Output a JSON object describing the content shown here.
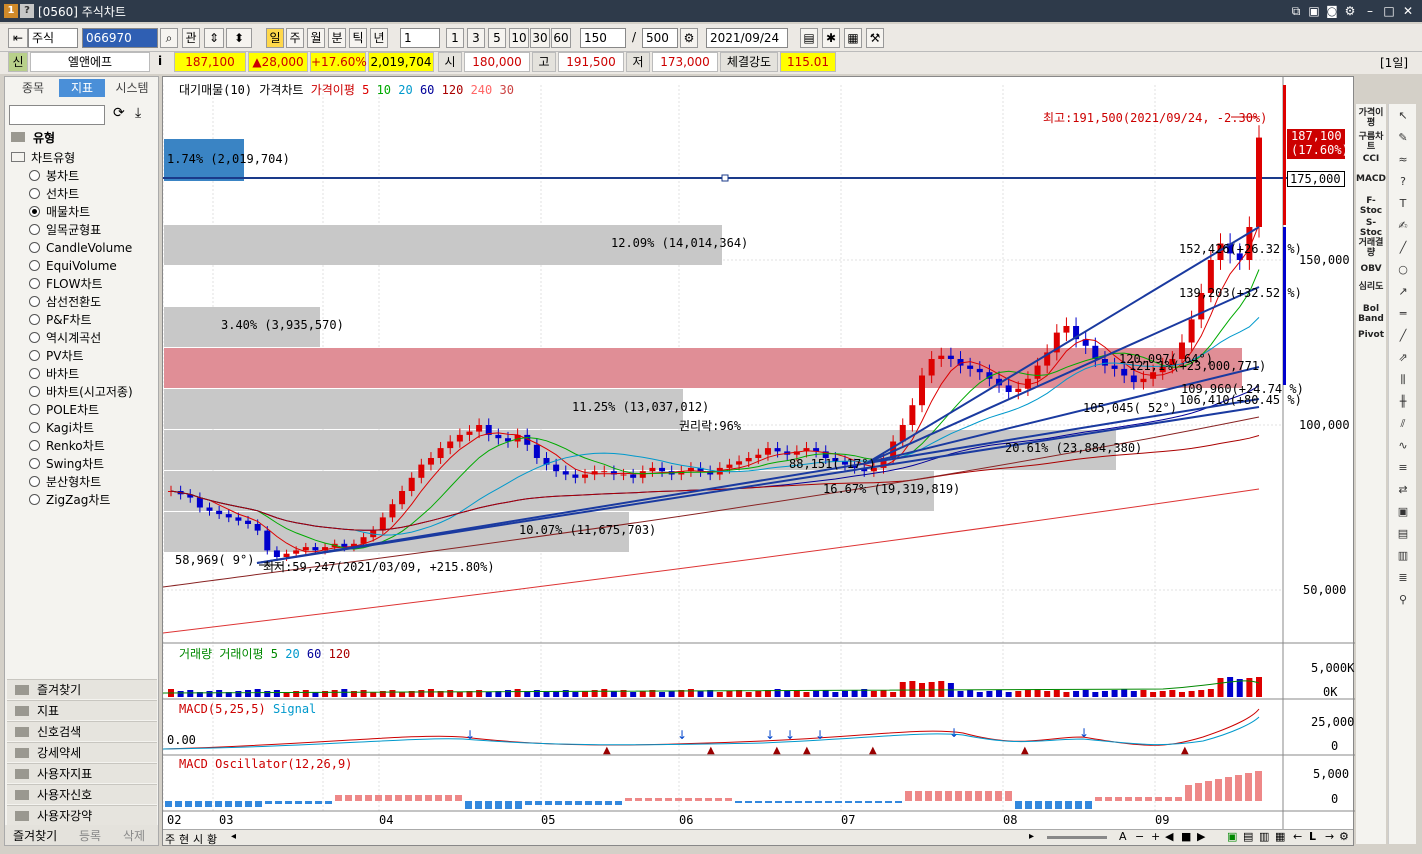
{
  "window": {
    "code": "[0560]",
    "title": "주식차트",
    "badge1": "1",
    "badge2": "?"
  },
  "toolbar": {
    "market": "주식",
    "code": "066970",
    "btn_gwan": "관",
    "periods": [
      "일",
      "주",
      "월",
      "분",
      "틱",
      "년"
    ],
    "interval": "1",
    "quick": [
      "1",
      "3",
      "5",
      "10",
      "30",
      "60"
    ],
    "count": "150",
    "slash": "/",
    "total": "500",
    "date": "2021/09/24"
  },
  "quote": {
    "badge": "신",
    "name": "엘앤에프",
    "info_icon": "i",
    "price": "187,100",
    "change": "▲28,000",
    "rate": "+17.60%",
    "volume": "2,019,704",
    "open_label": "시",
    "open": "180,000",
    "high_label": "고",
    "high": "191,500",
    "low_label": "저",
    "low": "173,000",
    "strength_label": "체결강도",
    "strength": "115.01",
    "period_tag": "[1일]"
  },
  "left": {
    "tabs": [
      "종목",
      "지표",
      "시스템"
    ],
    "active_tab": "지표",
    "section": "유형",
    "group": "차트유형",
    "types": [
      "봉차트",
      "선차트",
      "매물차트",
      "일목균형표",
      "CandleVolume",
      "EquiVolume",
      "FLOW차트",
      "삼선전환도",
      "P&F차트",
      "역시계곡선",
      "PV차트",
      "바차트",
      "바차트(시고저종)",
      "POLE차트",
      "Kagi차트",
      "Renko차트",
      "Swing차트",
      "분산형차트",
      "ZigZag차트"
    ],
    "selected": "매물차트",
    "folders": [
      "즐겨찾기",
      "지표",
      "신호검색",
      "강세약세",
      "사용자지표",
      "사용자신호",
      "사용자강약"
    ],
    "bottom_tabs": [
      "즐겨찾기",
      "등록",
      "삭제"
    ]
  },
  "main_legend": {
    "a": "대기매물(10)",
    "b": "가격차트",
    "c": "가격이평",
    "ma": [
      "5",
      "10",
      "20",
      "60",
      "120",
      "240",
      "30"
    ],
    "ma_colors": [
      "#dd0000",
      "#00aa00",
      "#0099cc",
      "#000099",
      "#aa0000",
      "#ff6666",
      "#cc4444"
    ]
  },
  "volume_profile": [
    {
      "label": "1.74% (2,019,704)",
      "pct": 1.74
    },
    {
      "label": "12.09% (14,014,364)",
      "pct": 12.09
    },
    {
      "label": "3.40% (3,935,570)",
      "pct": 3.4
    },
    {
      "label": "",
      "pct": 20.0
    },
    {
      "label": "11.25% (13,037,012)",
      "pct": 11.25
    },
    {
      "label": "20.61% (23,884,380)",
      "pct": 20.61
    },
    {
      "label": "16.67% (19,319,819)",
      "pct": 16.67
    },
    {
      "label": "10.07% (11,675,703)",
      "pct": 10.07
    }
  ],
  "annotations": {
    "high": "최고:191,500(2021/09/24, -2.30%)",
    "low": "최저:59,247(2021/03/09, +215.80%)",
    "rights": "권리락:96%",
    "t1": "58,969(  9°)",
    "t2": "88,151(  17°)",
    "t3": "105,045(  52°)",
    "t4": "106,410(+80.45 %)",
    "t5": "109,960(+24.74 %)",
    "t6": "120,097(  64°)",
    "t7": "121,1%(+23,000,771)",
    "t8": "139,203(+32.52 %)",
    "t9": "152,426(+26.32 %)"
  },
  "price_axis": {
    "labels": [
      "150,000",
      "100,000",
      "50,000"
    ],
    "line_value": "175,000",
    "last_price": "187,100",
    "last_rate": "(17.60%)"
  },
  "volume_panel": {
    "legend_a": "거래량",
    "legend_b": "거래이평",
    "ma": [
      "5",
      "20",
      "60",
      "120"
    ],
    "axis": [
      "5,000K",
      "0K"
    ]
  },
  "macd_panel": {
    "legend_a": "MACD(5,25,5)",
    "legend_b": "Signal",
    "zero": "0.00",
    "axis": [
      "25,000",
      "0"
    ]
  },
  "osc_panel": {
    "legend": "MACD Oscillator(12,26,9)",
    "axis": [
      "5,000",
      "0"
    ]
  },
  "x_axis": [
    "02",
    "03",
    "04",
    "05",
    "06",
    "07",
    "08",
    "09"
  ],
  "bottom_tabs": [
    "주",
    "현",
    "시",
    "황"
  ],
  "right_tools": [
    "가격이평",
    "구름차트",
    "CCI",
    "MACD",
    "F-Stoc",
    "S-Stoc",
    "거래결량",
    "OBV",
    "심리도",
    "Bol Band",
    "Pivot"
  ],
  "chart_data": {
    "type": "candlestick",
    "x_labels": [
      "02",
      "03",
      "04",
      "05",
      "06",
      "07",
      "08",
      "09"
    ],
    "y_ticks": [
      150000,
      100000,
      50000
    ],
    "high": 191500,
    "low": 59247,
    "last": 187100,
    "horizontal_line": 175000
  }
}
